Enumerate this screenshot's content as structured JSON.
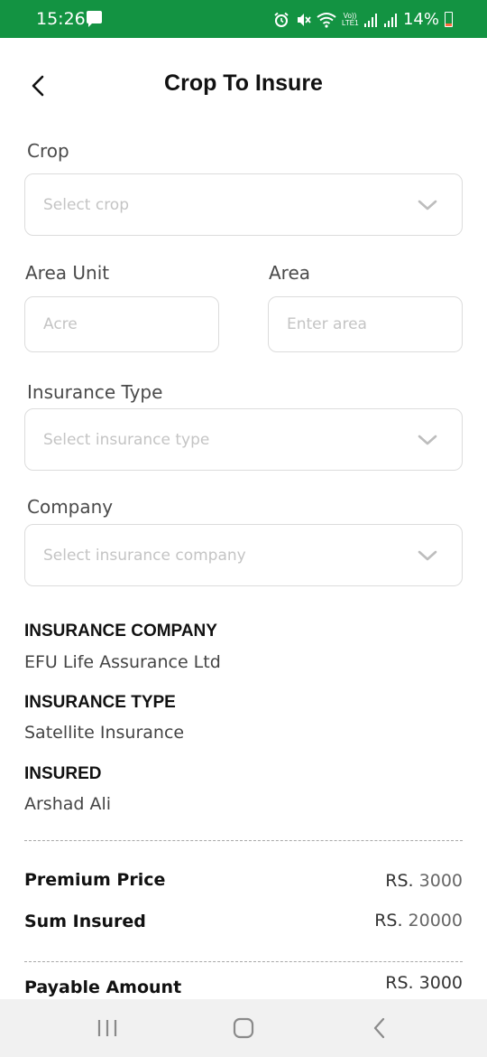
{
  "status_bar": {
    "time": "15:26",
    "battery": "14%",
    "network": "Vo)) LTE1",
    "accent_color": "#139342",
    "icons": [
      "message-icon",
      "alarm-icon",
      "mute-icon",
      "wifi-icon",
      "signal-icon",
      "battery-icon"
    ]
  },
  "header": {
    "title": "Crop To Insure"
  },
  "form": {
    "crop": {
      "label": "Crop",
      "placeholder": "Select crop"
    },
    "area_unit": {
      "label": "Area Unit",
      "placeholder": "Acre"
    },
    "area": {
      "label": "Area",
      "placeholder": "Enter area"
    },
    "insurance_type": {
      "label": "Insurance Type",
      "placeholder": "Select insurance type"
    },
    "company": {
      "label": "Company",
      "placeholder": "Select insurance company"
    }
  },
  "summary": {
    "company": {
      "heading": "INSURANCE COMPANY",
      "value": "EFU Life Assurance Ltd"
    },
    "type": {
      "heading": "INSURANCE TYPE",
      "value": "Satellite Insurance"
    },
    "insured": {
      "heading": "INSURED",
      "value": "Arshad Ali"
    }
  },
  "pricing": {
    "premium": {
      "label": "Premium Price",
      "currency": "RS.",
      "amount": "3000"
    },
    "sum_insured": {
      "label": "Sum Insured",
      "currency": "RS.",
      "amount": "20000"
    },
    "payable": {
      "label": "Payable Amount",
      "currency": "RS.",
      "amount": "3000"
    }
  }
}
